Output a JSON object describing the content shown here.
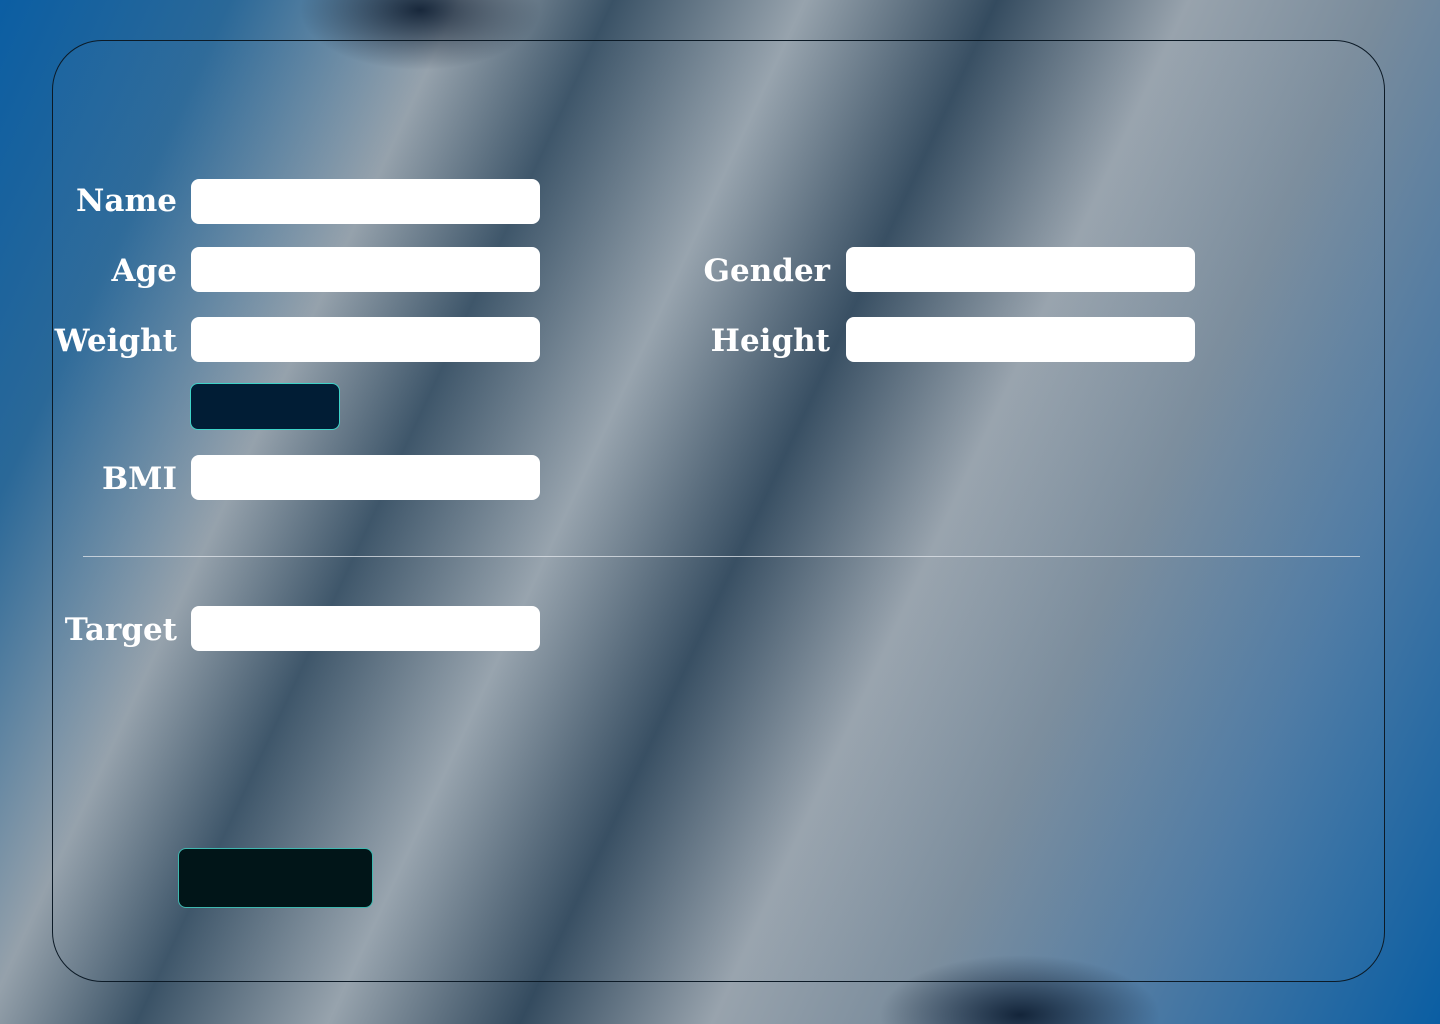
{
  "form": {
    "name": {
      "label": "Name",
      "value": ""
    },
    "age": {
      "label": "Age",
      "value": ""
    },
    "gender": {
      "label": "Gender",
      "value": ""
    },
    "weight": {
      "label": "Weight",
      "value": ""
    },
    "height": {
      "label": "Height",
      "value": ""
    },
    "calculate_button": {
      "label": ""
    },
    "bmi": {
      "label": "BMI",
      "value": ""
    },
    "target": {
      "label": "Target",
      "value": ""
    },
    "bottom_button": {
      "label": ""
    }
  },
  "colors": {
    "button_fill": "#011d35",
    "button_border": "#3fd3c8",
    "bottom_button_fill": "#011518",
    "input_fill": "#ffffff",
    "label_color": "#ffffff"
  }
}
